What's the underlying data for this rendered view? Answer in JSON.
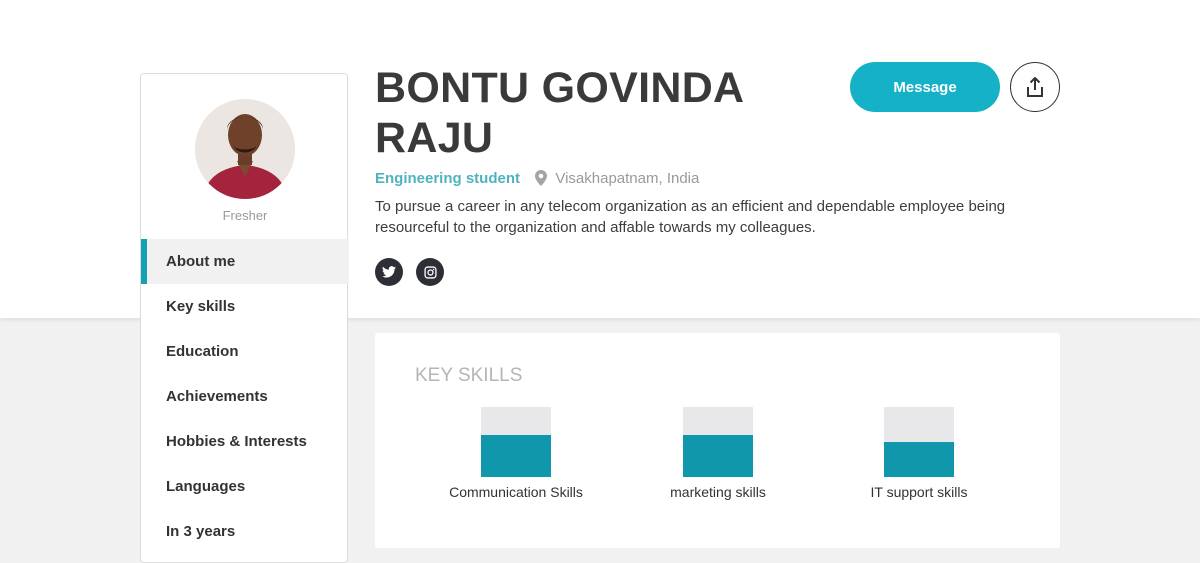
{
  "profile": {
    "name": "BONTU GOVINDA RAJU",
    "headline": "Engineering student",
    "location": "Visakhapatnam, India",
    "summary": "To pursue a career in any telecom organization as an efficient and dependable employee being resourceful to the organization and affable towards my colleagues.",
    "status": "Fresher"
  },
  "actions": {
    "message_label": "Message",
    "share_icon": "share-icon"
  },
  "social": [
    {
      "icon": "twitter-icon"
    },
    {
      "icon": "instagram-icon"
    }
  ],
  "nav": {
    "active": "About me",
    "items": [
      {
        "label": "About me"
      },
      {
        "label": "Key skills"
      },
      {
        "label": "Education"
      },
      {
        "label": "Achievements"
      },
      {
        "label": "Hobbies & Interests"
      },
      {
        "label": "Languages"
      },
      {
        "label": "In 3 years"
      }
    ]
  },
  "skills": {
    "title": "KEY SKILLS",
    "items": [
      {
        "label": "Communication Skills",
        "level": 0.6
      },
      {
        "label": "marketing skills",
        "level": 0.6
      },
      {
        "label": "IT support skills",
        "level": 0.5
      }
    ]
  },
  "colors": {
    "accent": "#14b1c7",
    "skill_bar": "#1097ab",
    "headline": "#4fb3bf"
  }
}
